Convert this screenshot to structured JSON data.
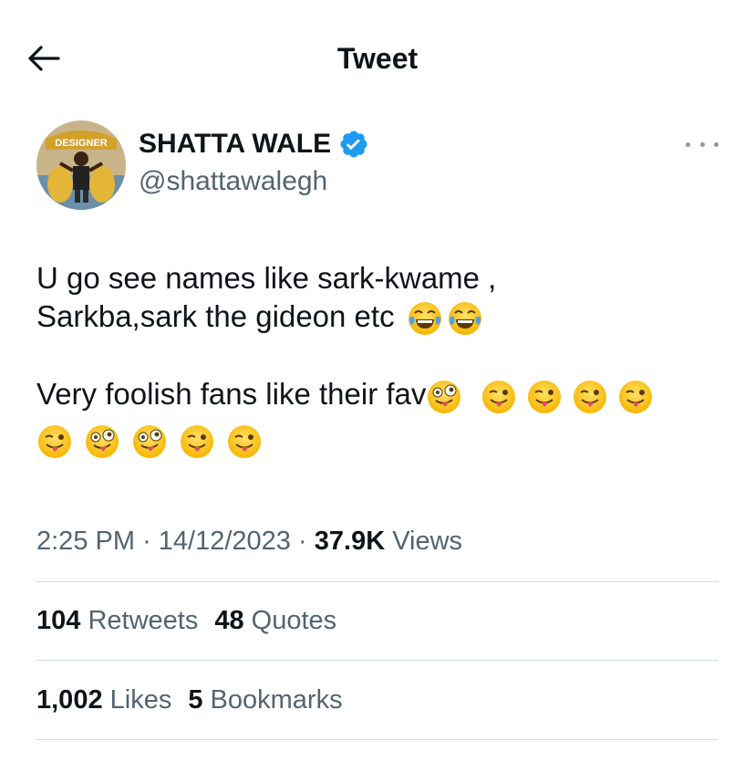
{
  "header": {
    "title": "Tweet",
    "back_icon": "arrow-left-icon"
  },
  "author": {
    "name": "SHATTA WALE",
    "handle": "@shattawalegh",
    "verified_icon": "verified-badge-icon",
    "avatar_banner_text": "DESIGNER"
  },
  "tweet": {
    "line1": "U go see names like sark-kwame ,",
    "line2": "Sarkba,sark the gideon etc",
    "line2_emojis": [
      "face-with-tears-of-joy",
      "face-with-tears-of-joy"
    ],
    "line3": "Very foolish fans like their fav",
    "line3_emojis": [
      "zany-face",
      "winking-face-with-tongue",
      "winking-face-with-tongue",
      "winking-face-with-tongue",
      "winking-face-with-tongue"
    ],
    "line4_emojis": [
      "winking-face-with-tongue",
      "zany-face",
      "zany-face",
      "winking-face-with-tongue",
      "winking-face-with-tongue"
    ]
  },
  "meta": {
    "time": "2:25 PM",
    "separator": "·",
    "date": "14/12/2023",
    "views_count": "37.9K",
    "views_label": "Views"
  },
  "stats_row1": {
    "retweets_count": "104",
    "retweets_label": "Retweets",
    "quotes_count": "48",
    "quotes_label": "Quotes"
  },
  "stats_row2": {
    "likes_count": "1,002",
    "likes_label": "Likes",
    "bookmarks_count": "5",
    "bookmarks_label": "Bookmarks"
  },
  "colors": {
    "text": "#0f1419",
    "secondary": "#536471",
    "verified": "#1d9bf0",
    "divider": "#cfd9de"
  }
}
